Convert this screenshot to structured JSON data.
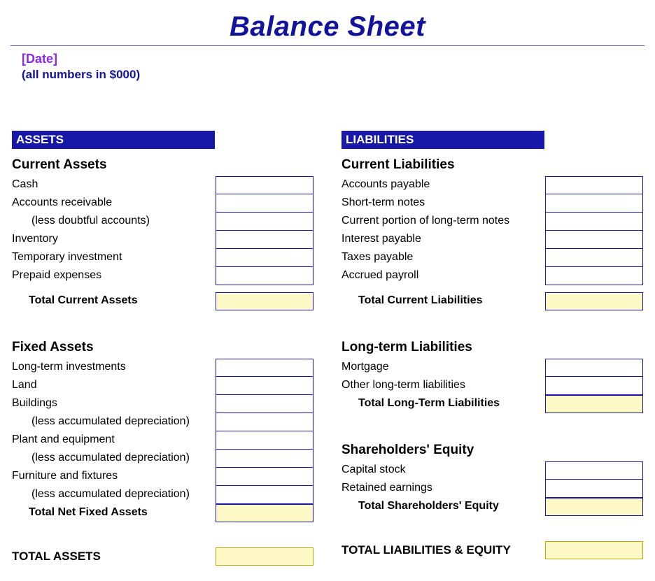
{
  "title": "Balance Sheet",
  "date": "[Date]",
  "note": "(all numbers in $000)",
  "left": {
    "header": "ASSETS",
    "section1": {
      "heading": "Current Assets",
      "items": [
        "Cash",
        "Accounts receivable",
        "(less doubtful accounts)",
        "Inventory",
        "Temporary investment",
        "Prepaid expenses"
      ],
      "total_label": "Total Current Assets"
    },
    "section2": {
      "heading": "Fixed Assets",
      "items": [
        "Long-term investments",
        "Land",
        "Buildings",
        "(less accumulated depreciation)",
        "Plant and equipment",
        "(less accumulated depreciation)",
        "Furniture and fixtures",
        "(less accumulated depreciation)"
      ],
      "total_label": "Total Net Fixed Assets"
    },
    "grand_label": "TOTAL ASSETS"
  },
  "right": {
    "header": "LIABILITIES",
    "section1": {
      "heading": "Current Liabilities",
      "items": [
        "Accounts payable",
        "Short-term notes",
        "Current portion of long-term notes",
        "Interest payable",
        "Taxes payable",
        "Accrued payroll"
      ],
      "total_label": "Total Current Liabilities"
    },
    "section2": {
      "heading": "Long-term Liabilities",
      "items": [
        "Mortgage",
        "Other long-term liabilities"
      ],
      "total_label": "Total Long-Term Liabilities"
    },
    "section3": {
      "heading": "Shareholders' Equity",
      "items": [
        "Capital stock",
        "Retained earnings"
      ],
      "total_label": "Total Shareholders' Equity"
    },
    "grand_label": "TOTAL LIABILITIES & EQUITY"
  }
}
